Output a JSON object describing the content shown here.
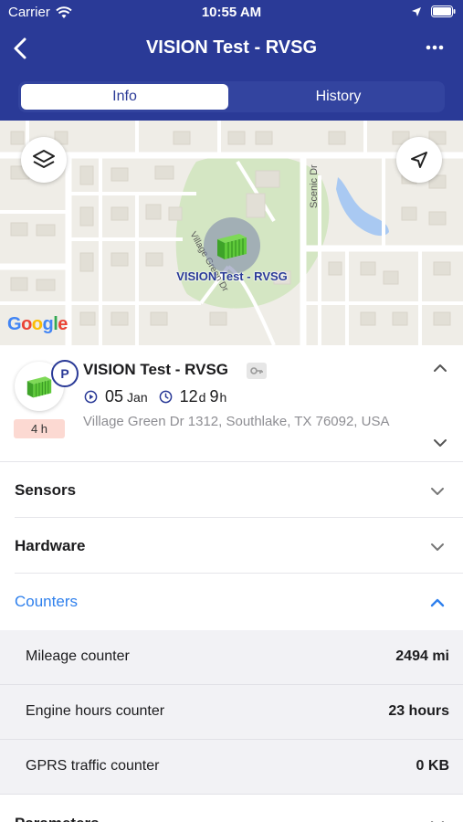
{
  "status_bar": {
    "carrier": "Carrier",
    "time": "10:55 AM"
  },
  "nav": {
    "title": "VISION Test - RVSG",
    "back_icon": "chevron-left-icon",
    "more_icon": "ellipsis-icon"
  },
  "tabs": [
    {
      "label": "Info",
      "selected": true
    },
    {
      "label": "History",
      "selected": false
    }
  ],
  "map": {
    "marker_label": "VISION Test - RVSG",
    "street_labels": [
      "Scenic Dr",
      "Village Green Dr"
    ],
    "attribution": "Google"
  },
  "unit": {
    "name": "VISION Test - RVSG",
    "status_badge": "P",
    "age": "4 h",
    "date_day": "05",
    "date_month": "Jan",
    "duration_days": "12",
    "duration_days_unit": "d",
    "duration_hours": "9",
    "duration_hours_unit": "h",
    "address": "Village Green Dr 1312, Southlake, TX 76092, USA"
  },
  "sections": [
    {
      "title": "Sensors",
      "expanded": false
    },
    {
      "title": "Hardware",
      "expanded": false
    },
    {
      "title": "Counters",
      "expanded": true
    },
    {
      "title": "Parameters",
      "expanded": false
    }
  ],
  "counters": [
    {
      "label": "Mileage counter",
      "value": "2494 mi"
    },
    {
      "label": "Engine hours counter",
      "value": "23 hours"
    },
    {
      "label": "GPRS traffic counter",
      "value": "0 KB"
    }
  ],
  "colors": {
    "header": "#2a3a97",
    "accent": "#2f80ed",
    "age_badge": "#fcd9d2"
  }
}
